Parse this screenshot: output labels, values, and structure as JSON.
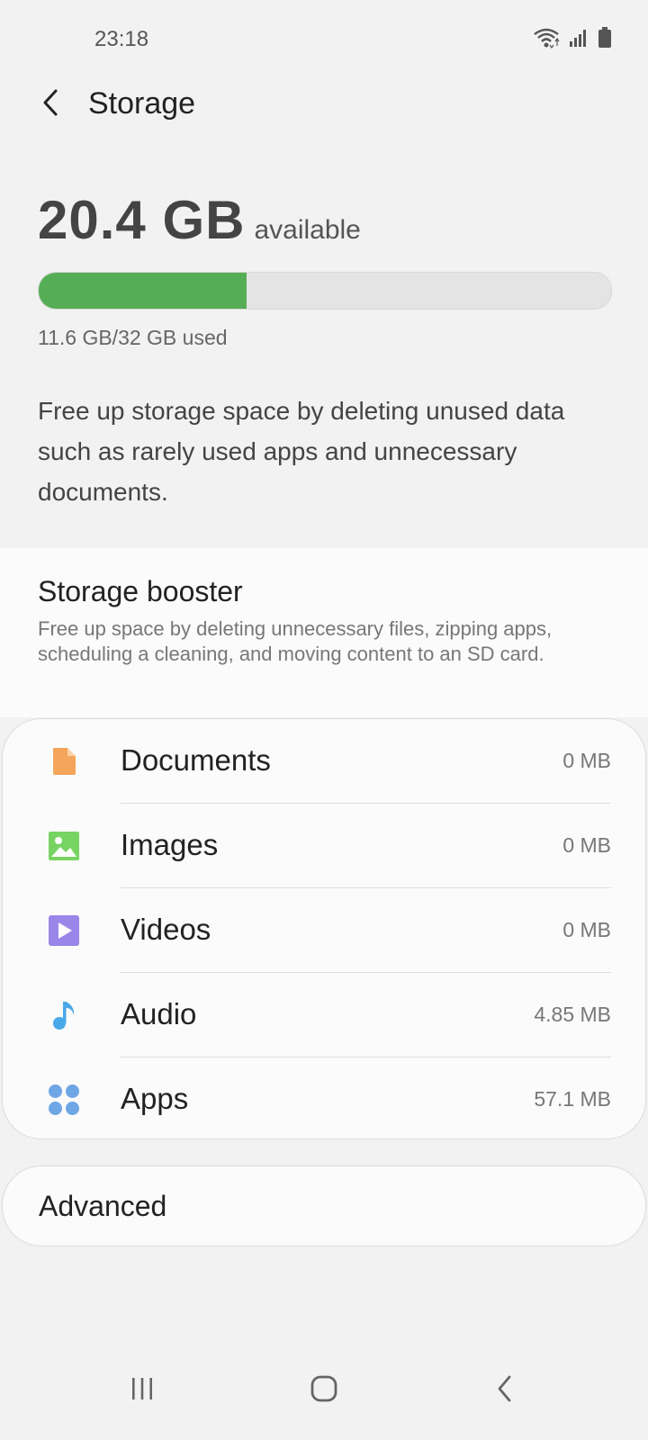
{
  "status_bar": {
    "time": "23:18",
    "icons": [
      "wifi-icon",
      "signal-icon",
      "battery-icon"
    ]
  },
  "header": {
    "title": "Storage",
    "back_icon": "chevron-left-icon"
  },
  "summary": {
    "available_value": "20.4 GB",
    "available_label": "available",
    "used_text": "11.6 GB/32 GB used",
    "used_fraction": 0.3625,
    "bar_color": "#55ae55"
  },
  "description": "Free up storage space by deleting unused data such as rarely used apps and unnecessary documents.",
  "booster": {
    "title": "Storage booster",
    "description": "Free up space by deleting unnecessary files, zipping apps, scheduling a cleaning, and moving content to an SD card."
  },
  "categories": [
    {
      "label": "Documents",
      "size": "0 MB",
      "icon": "document-icon",
      "color": "#f5a55a"
    },
    {
      "label": "Images",
      "size": "0 MB",
      "icon": "image-icon",
      "color": "#78d462"
    },
    {
      "label": "Videos",
      "size": "0 MB",
      "icon": "video-icon",
      "color": "#9a86e8"
    },
    {
      "label": "Audio",
      "size": "4.85 MB",
      "icon": "music-note-icon",
      "color": "#4aa8e8"
    },
    {
      "label": "Apps",
      "size": "57.1 MB",
      "icon": "apps-icon",
      "color": "#6fa6e6"
    }
  ],
  "advanced": {
    "label": "Advanced"
  },
  "nav_bar": {
    "icons": [
      "recents-icon",
      "home-icon",
      "back-icon"
    ]
  }
}
